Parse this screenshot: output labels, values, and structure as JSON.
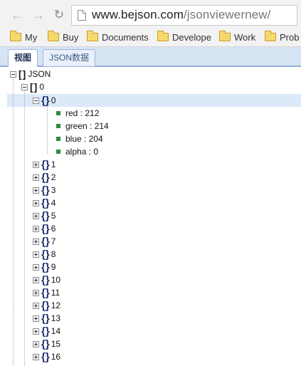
{
  "browser": {
    "url_host": "www.bejson.com",
    "url_path": "/jsonviewernew/",
    "bookmarks": [
      "My",
      "Buy",
      "Documents",
      "Develope",
      "Work",
      "Prob"
    ]
  },
  "tabs": [
    {
      "label": "视图",
      "active": true
    },
    {
      "label": "JSON数据",
      "active": false
    }
  ],
  "tree": {
    "root_label": "JSON",
    "level1_label": "0",
    "expanded_label": "0",
    "leaves": [
      "red : 212",
      "green : 214",
      "blue : 204",
      "alpha : 0"
    ],
    "collapsed": [
      "1",
      "2",
      "3",
      "4",
      "5",
      "6",
      "7",
      "8",
      "9",
      "10",
      "11",
      "12",
      "13",
      "14",
      "15",
      "16"
    ]
  },
  "icons": {
    "back": "back-arrow-icon",
    "forward": "forward-arrow-icon",
    "reload": "reload-icon",
    "page": "page-icon",
    "folder": "folder-icon",
    "expand": "plus-box-icon",
    "collapse": "minus-box-icon",
    "leaf": "green-square-icon"
  },
  "colors": {
    "selected_row": "#dce9f9",
    "tab_bar": "#d7e4f4",
    "leaf_icon": "#2e8b3e",
    "brace": "#1a2e6e"
  }
}
